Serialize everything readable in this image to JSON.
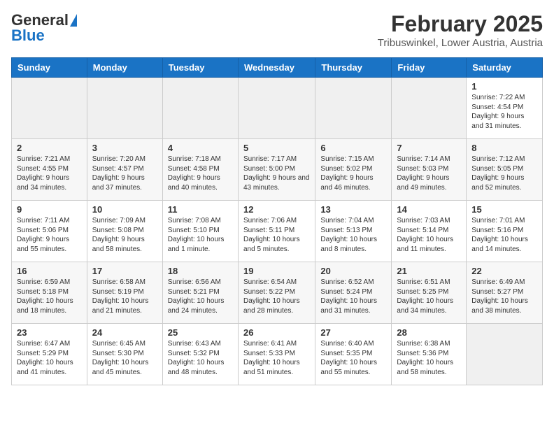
{
  "logo": {
    "line1": "General",
    "line2": "Blue"
  },
  "title": "February 2025",
  "subtitle": "Tribuswinkel, Lower Austria, Austria",
  "days_of_week": [
    "Sunday",
    "Monday",
    "Tuesday",
    "Wednesday",
    "Thursday",
    "Friday",
    "Saturday"
  ],
  "weeks": [
    [
      {
        "day": "",
        "info": ""
      },
      {
        "day": "",
        "info": ""
      },
      {
        "day": "",
        "info": ""
      },
      {
        "day": "",
        "info": ""
      },
      {
        "day": "",
        "info": ""
      },
      {
        "day": "",
        "info": ""
      },
      {
        "day": "1",
        "info": "Sunrise: 7:22 AM\nSunset: 4:54 PM\nDaylight: 9 hours and 31 minutes."
      }
    ],
    [
      {
        "day": "2",
        "info": "Sunrise: 7:21 AM\nSunset: 4:55 PM\nDaylight: 9 hours and 34 minutes."
      },
      {
        "day": "3",
        "info": "Sunrise: 7:20 AM\nSunset: 4:57 PM\nDaylight: 9 hours and 37 minutes."
      },
      {
        "day": "4",
        "info": "Sunrise: 7:18 AM\nSunset: 4:58 PM\nDaylight: 9 hours and 40 minutes."
      },
      {
        "day": "5",
        "info": "Sunrise: 7:17 AM\nSunset: 5:00 PM\nDaylight: 9 hours and 43 minutes."
      },
      {
        "day": "6",
        "info": "Sunrise: 7:15 AM\nSunset: 5:02 PM\nDaylight: 9 hours and 46 minutes."
      },
      {
        "day": "7",
        "info": "Sunrise: 7:14 AM\nSunset: 5:03 PM\nDaylight: 9 hours and 49 minutes."
      },
      {
        "day": "8",
        "info": "Sunrise: 7:12 AM\nSunset: 5:05 PM\nDaylight: 9 hours and 52 minutes."
      }
    ],
    [
      {
        "day": "9",
        "info": "Sunrise: 7:11 AM\nSunset: 5:06 PM\nDaylight: 9 hours and 55 minutes."
      },
      {
        "day": "10",
        "info": "Sunrise: 7:09 AM\nSunset: 5:08 PM\nDaylight: 9 hours and 58 minutes."
      },
      {
        "day": "11",
        "info": "Sunrise: 7:08 AM\nSunset: 5:10 PM\nDaylight: 10 hours and 1 minute."
      },
      {
        "day": "12",
        "info": "Sunrise: 7:06 AM\nSunset: 5:11 PM\nDaylight: 10 hours and 5 minutes."
      },
      {
        "day": "13",
        "info": "Sunrise: 7:04 AM\nSunset: 5:13 PM\nDaylight: 10 hours and 8 minutes."
      },
      {
        "day": "14",
        "info": "Sunrise: 7:03 AM\nSunset: 5:14 PM\nDaylight: 10 hours and 11 minutes."
      },
      {
        "day": "15",
        "info": "Sunrise: 7:01 AM\nSunset: 5:16 PM\nDaylight: 10 hours and 14 minutes."
      }
    ],
    [
      {
        "day": "16",
        "info": "Sunrise: 6:59 AM\nSunset: 5:18 PM\nDaylight: 10 hours and 18 minutes."
      },
      {
        "day": "17",
        "info": "Sunrise: 6:58 AM\nSunset: 5:19 PM\nDaylight: 10 hours and 21 minutes."
      },
      {
        "day": "18",
        "info": "Sunrise: 6:56 AM\nSunset: 5:21 PM\nDaylight: 10 hours and 24 minutes."
      },
      {
        "day": "19",
        "info": "Sunrise: 6:54 AM\nSunset: 5:22 PM\nDaylight: 10 hours and 28 minutes."
      },
      {
        "day": "20",
        "info": "Sunrise: 6:52 AM\nSunset: 5:24 PM\nDaylight: 10 hours and 31 minutes."
      },
      {
        "day": "21",
        "info": "Sunrise: 6:51 AM\nSunset: 5:25 PM\nDaylight: 10 hours and 34 minutes."
      },
      {
        "day": "22",
        "info": "Sunrise: 6:49 AM\nSunset: 5:27 PM\nDaylight: 10 hours and 38 minutes."
      }
    ],
    [
      {
        "day": "23",
        "info": "Sunrise: 6:47 AM\nSunset: 5:29 PM\nDaylight: 10 hours and 41 minutes."
      },
      {
        "day": "24",
        "info": "Sunrise: 6:45 AM\nSunset: 5:30 PM\nDaylight: 10 hours and 45 minutes."
      },
      {
        "day": "25",
        "info": "Sunrise: 6:43 AM\nSunset: 5:32 PM\nDaylight: 10 hours and 48 minutes."
      },
      {
        "day": "26",
        "info": "Sunrise: 6:41 AM\nSunset: 5:33 PM\nDaylight: 10 hours and 51 minutes."
      },
      {
        "day": "27",
        "info": "Sunrise: 6:40 AM\nSunset: 5:35 PM\nDaylight: 10 hours and 55 minutes."
      },
      {
        "day": "28",
        "info": "Sunrise: 6:38 AM\nSunset: 5:36 PM\nDaylight: 10 hours and 58 minutes."
      },
      {
        "day": "",
        "info": ""
      }
    ]
  ]
}
